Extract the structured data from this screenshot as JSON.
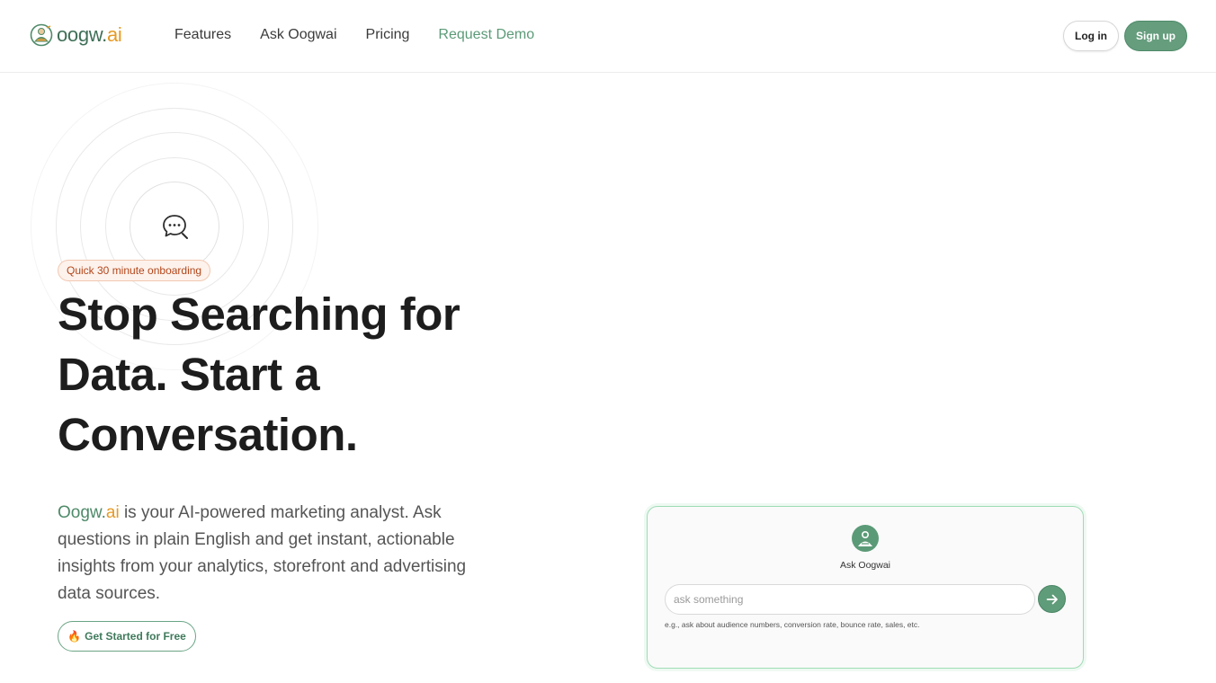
{
  "header": {
    "logo_main": "oogw.",
    "logo_ai": "ai",
    "nav": [
      "Features",
      "Ask Oogwai",
      "Pricing",
      "Request Demo"
    ],
    "login_label": "Log in",
    "signup_label": "Sign up"
  },
  "hero": {
    "badge": "Quick 30 minute onboarding",
    "headline": "Stop Searching for Data. Start a Conversation.",
    "desc_brand": "Oogw.",
    "desc_brand_ai": "ai",
    "desc_text": " is your AI-powered marketing analyst. Ask questions in plain English and get instant, actionable insights from your analytics, storefront and advertising data sources.",
    "cta_icon": "🔥",
    "cta_label": "Get Started for Free"
  },
  "ask_card": {
    "title": "Ask Oogwai",
    "input_placeholder": "ask something",
    "hint": "e.g., ask about audience numbers, conversion rate, bounce rate, sales, etc."
  },
  "colors": {
    "brand_green": "#659d7d",
    "brand_orange": "#e69a24",
    "badge_text": "#b3461a"
  },
  "icons": {
    "logo": "oogwai-logo-icon",
    "chat": "chat-bubble-search-icon",
    "send": "arrow-right-icon",
    "avatar": "oogwai-avatar-icon"
  }
}
